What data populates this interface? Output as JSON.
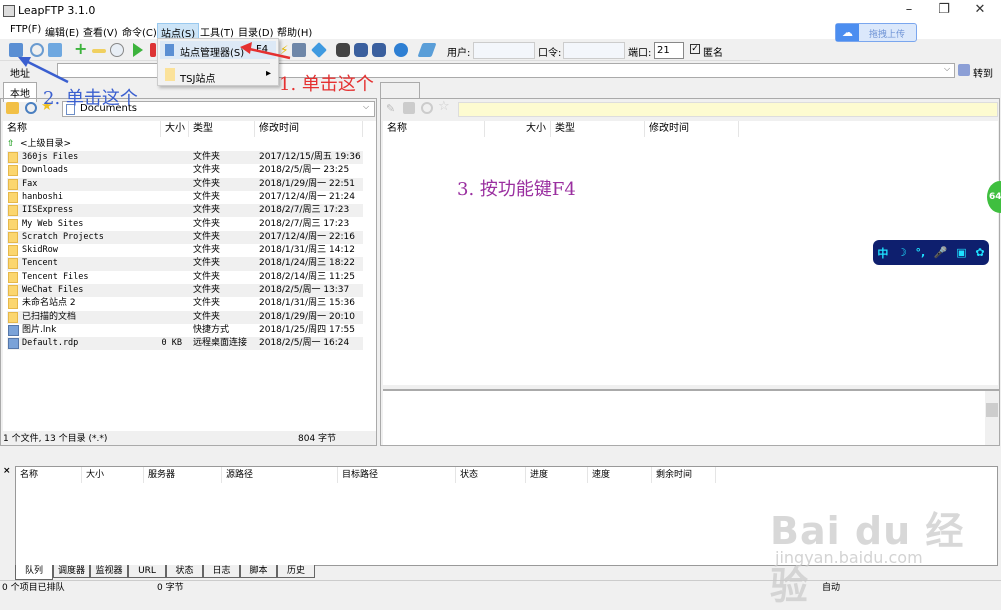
{
  "window": {
    "title": "LeapFTP 3.1.0",
    "minimize": "–",
    "maximize": "❐",
    "close": "✕"
  },
  "menubar": [
    "FTP(F)",
    "编辑(E)",
    "查看(V)",
    "命令(C)",
    "站点(S)",
    "工具(T)",
    "目录(D)",
    "帮助(H)"
  ],
  "dropdown": {
    "items": [
      {
        "label": "站点管理器(S)",
        "shortcut": "F4"
      },
      {
        "label": "TSJ站点",
        "arrow": "▸"
      }
    ]
  },
  "toolbar": {
    "user_label": "用户:",
    "user_value": "",
    "pass_label": "口令:",
    "pass_value": "",
    "port_label": "端口:",
    "port_value": "21",
    "anon_label": "匿名",
    "anon_checked": true
  },
  "upload_badge": "拖拽上传",
  "address": {
    "label": "地址",
    "go_label": "转到",
    "value": ""
  },
  "tabs": {
    "local": "本地"
  },
  "local": {
    "path": "Documents",
    "columns": [
      "名称",
      "大小",
      "类型",
      "修改时间"
    ],
    "parent": "<上级目录>",
    "files": [
      {
        "name": "360js Files",
        "size": "",
        "type": "文件夹",
        "date": "2017/12/15/周五 19:36",
        "kind": "folder"
      },
      {
        "name": "Downloads",
        "size": "",
        "type": "文件夹",
        "date": "2018/2/5/周一 23:25",
        "kind": "folder"
      },
      {
        "name": "Fax",
        "size": "",
        "type": "文件夹",
        "date": "2018/1/29/周一 22:51",
        "kind": "folder"
      },
      {
        "name": "hanboshi",
        "size": "",
        "type": "文件夹",
        "date": "2017/12/4/周一 21:24",
        "kind": "folder"
      },
      {
        "name": "IISExpress",
        "size": "",
        "type": "文件夹",
        "date": "2018/2/7/周三 17:23",
        "kind": "folder"
      },
      {
        "name": "My Web Sites",
        "size": "",
        "type": "文件夹",
        "date": "2018/2/7/周三 17:23",
        "kind": "folder"
      },
      {
        "name": "Scratch Projects",
        "size": "",
        "type": "文件夹",
        "date": "2017/12/4/周一 22:16",
        "kind": "folder"
      },
      {
        "name": "SkidRow",
        "size": "",
        "type": "文件夹",
        "date": "2018/1/31/周三 14:12",
        "kind": "folder"
      },
      {
        "name": "Tencent",
        "size": "",
        "type": "文件夹",
        "date": "2018/1/24/周三 18:22",
        "kind": "folder"
      },
      {
        "name": "Tencent Files",
        "size": "",
        "type": "文件夹",
        "date": "2018/2/14/周三 11:25",
        "kind": "folder"
      },
      {
        "name": "WeChat Files",
        "size": "",
        "type": "文件夹",
        "date": "2018/2/5/周一 13:37",
        "kind": "folder"
      },
      {
        "name": "未命名站点 2",
        "size": "",
        "type": "文件夹",
        "date": "2018/1/31/周三 15:36",
        "kind": "folder"
      },
      {
        "name": "已扫描的文档",
        "size": "",
        "type": "文件夹",
        "date": "2018/1/29/周一 20:10",
        "kind": "folder"
      },
      {
        "name": "图片.lnk",
        "size": "",
        "type": "快捷方式",
        "date": "2018/1/25/周四 17:55",
        "kind": "file"
      },
      {
        "name": "Default.rdp",
        "size": "0 KB",
        "type": "远程桌面连接",
        "date": "2018/2/5/周一 16:24",
        "kind": "file"
      }
    ],
    "status_left": "1 个文件, 13 个目录 (*.*)",
    "status_right": "804 字节"
  },
  "remote": {
    "columns": [
      "名称",
      "大小",
      "类型",
      "修改时间"
    ]
  },
  "queue": {
    "columns": [
      "名称",
      "大小",
      "服务器",
      "源路径",
      "目标路径",
      "状态",
      "进度",
      "速度",
      "剩余时间"
    ],
    "tabs": [
      "队列",
      "调度器",
      "监视器",
      "URL",
      "状态",
      "日志",
      "脚本",
      "历史"
    ],
    "status_left": "0 个项目已排队",
    "status_mid": "0 字节",
    "status_right": "自动"
  },
  "ime": {
    "items": [
      "中",
      "☽",
      "°,",
      "🎤",
      "▣",
      "✿"
    ]
  },
  "side_badge": "64",
  "annotations": {
    "step1": "1. 单击这个",
    "step2": "2. 单击这个",
    "step3": "3. 按功能键F4"
  },
  "watermark": {
    "brand": "Bai du 经验",
    "url": "jingyan.baidu.com"
  }
}
